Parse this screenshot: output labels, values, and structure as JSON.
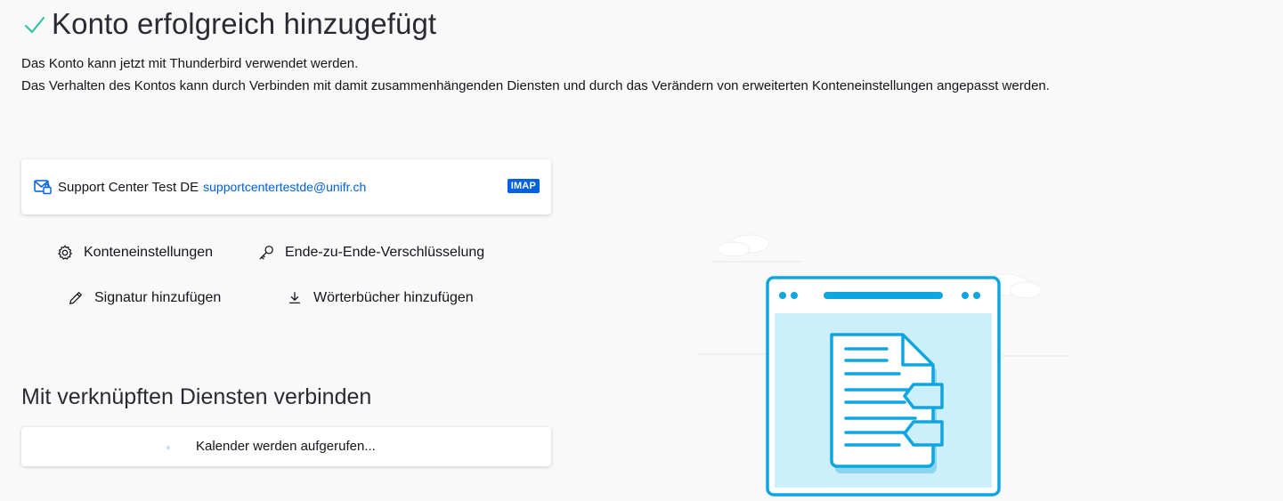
{
  "header": {
    "title": "Konto erfolgreich hinzugefügt",
    "check_color": "#2ac3a2",
    "description_line1": "Das Konto kann jetzt mit Thunderbird verwendet werden.",
    "description_line2": "Das Verhalten des Kontos kann durch Verbinden mit damit zusammenhängenden Diensten und durch das Verändern von erweiterten Konteneinstellungen angepasst werden."
  },
  "account": {
    "name": "Support Center Test DE",
    "email": "supportcentertestde@unifr.ch",
    "protocol_badge": "IMAP",
    "accent_color": "#0061e0",
    "icon": "mail-lock-icon"
  },
  "actions": {
    "account_settings": {
      "label": "Konteneinstellungen",
      "icon": "gear-icon"
    },
    "e2e_encryption": {
      "label": "Ende-zu-Ende-Verschlüsselung",
      "icon": "key-icon"
    },
    "add_signature": {
      "label": "Signatur hinzufügen",
      "icon": "pencil-icon"
    },
    "add_dictionaries": {
      "label": "Wörterbücher hinzufügen",
      "icon": "download-icon"
    }
  },
  "linked_services": {
    "title": "Mit verknüpften Diensten verbinden",
    "calendar_status": "Kalender werden aufgerufen..."
  },
  "illustration": {
    "icon": "document-window-illustration",
    "stroke_color": "#0ea5e0",
    "fill_color": "#cdeefb"
  }
}
